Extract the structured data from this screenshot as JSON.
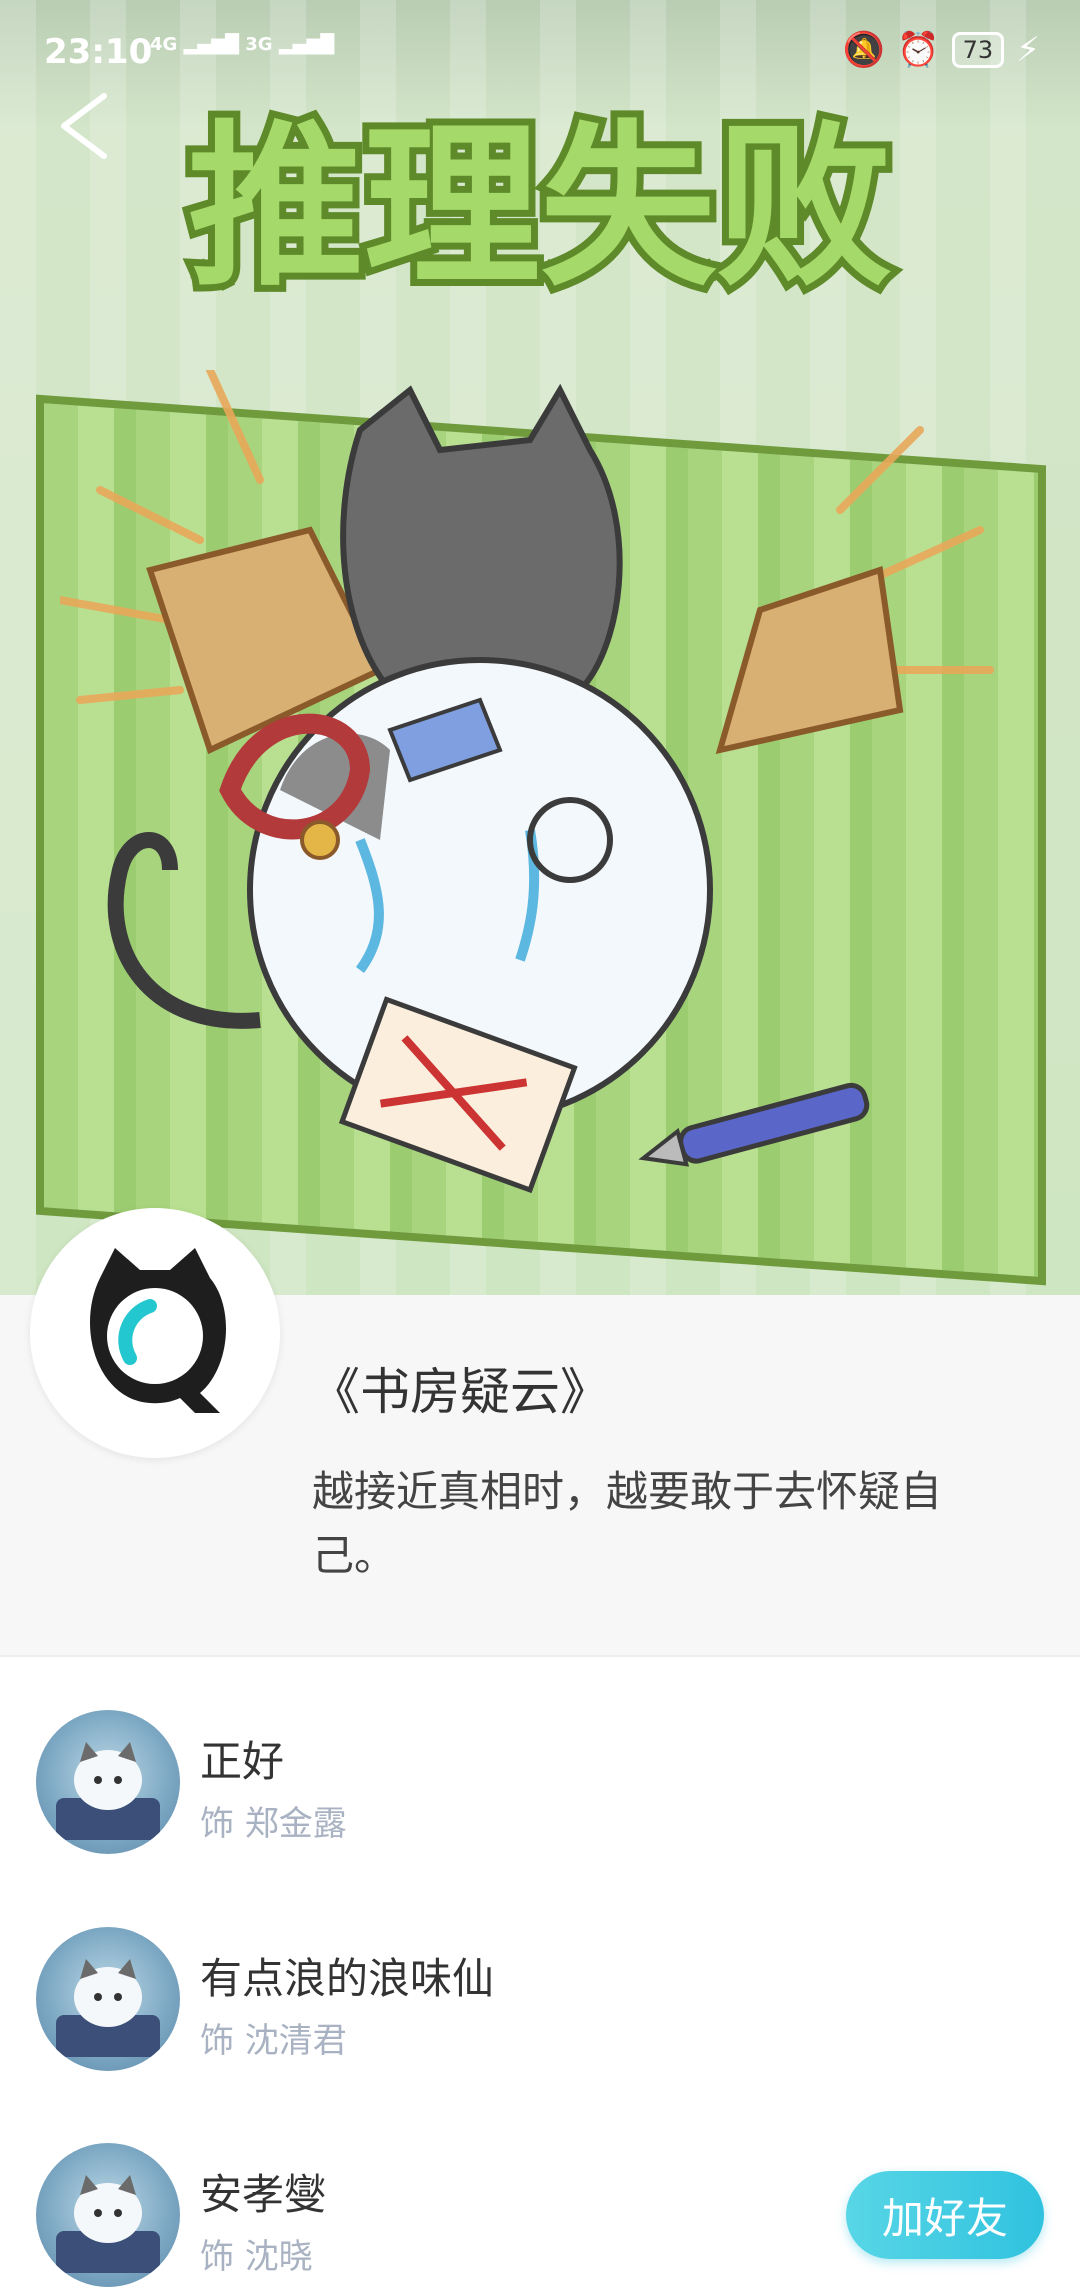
{
  "status_bar": {
    "time": "23:10",
    "network_1": "4G",
    "network_2": "3G",
    "battery": "73"
  },
  "hero": {
    "banner_title": "推理失败"
  },
  "script": {
    "title": "《书房疑云》",
    "description": "越接近真相时，越要敢于去怀疑自己。"
  },
  "cast": [
    {
      "name": "正好",
      "role": "饰 郑金露"
    },
    {
      "name": "有点浪的浪味仙",
      "role": "饰 沈清君"
    },
    {
      "name": "安孝燮",
      "role": "饰 沈晓"
    }
  ],
  "actions": {
    "add_friend": "加好友"
  },
  "colors": {
    "accent": "#30c2df",
    "banner_green": "#9ccc70",
    "role_text": "#a9b2c2"
  }
}
